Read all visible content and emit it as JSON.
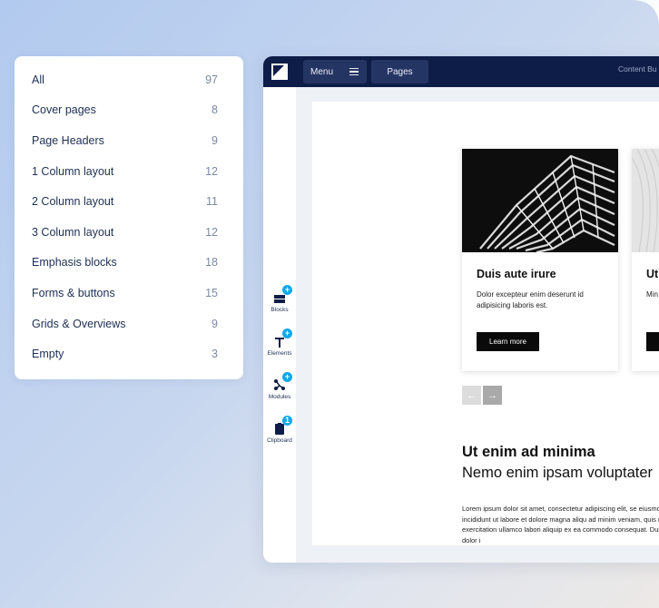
{
  "categories": [
    {
      "label": "All",
      "count": "97"
    },
    {
      "label": "Cover pages",
      "count": "8"
    },
    {
      "label": "Page Headers",
      "count": "9"
    },
    {
      "label": "1 Column layout",
      "count": "12"
    },
    {
      "label": "2 Column layout",
      "count": "11"
    },
    {
      "label": "3 Column layout",
      "count": "12"
    },
    {
      "label": "Emphasis blocks",
      "count": "18"
    },
    {
      "label": "Forms & buttons",
      "count": "15"
    },
    {
      "label": "Grids & Overviews",
      "count": "9"
    },
    {
      "label": "Empty",
      "count": "3"
    }
  ],
  "topbar": {
    "menu_label": "Menu",
    "pages_label": "Pages",
    "right_text": "Content  Bu"
  },
  "tools": [
    {
      "label": "Blocks",
      "icon": "blocks-icon",
      "badge": "+"
    },
    {
      "label": "Elements",
      "icon": "elements-icon",
      "badge": "+"
    },
    {
      "label": "Modules",
      "icon": "modules-icon",
      "badge": "+"
    },
    {
      "label": "Clipboard",
      "icon": "clipboard-icon",
      "badge": "1"
    }
  ],
  "cards": [
    {
      "title": "Duis aute irure",
      "text": "Dolor excepteur enim deserunt id adipisicing laboris est.",
      "button": "Learn more"
    },
    {
      "title": "Ut",
      "text": "Min amo qui",
      "button": "L"
    }
  ],
  "section": {
    "title": "Ut enim ad minima",
    "subtitle": "Nemo enim ipsam voluptater",
    "body": "Lorem ipsum dolor sit amet, consectetur adipiscing elit, se eiusmod tempor incididunt ut labore et dolore magna aliqu ad minim veniam, quis nostrud exercitation ullamco labori aliquip ex ea commodo consequat. Duis aute irure dolor i"
  },
  "colors": {
    "navy": "#0e1d48",
    "accent": "#13a8ea",
    "button_dark": "#0a0a0a"
  }
}
